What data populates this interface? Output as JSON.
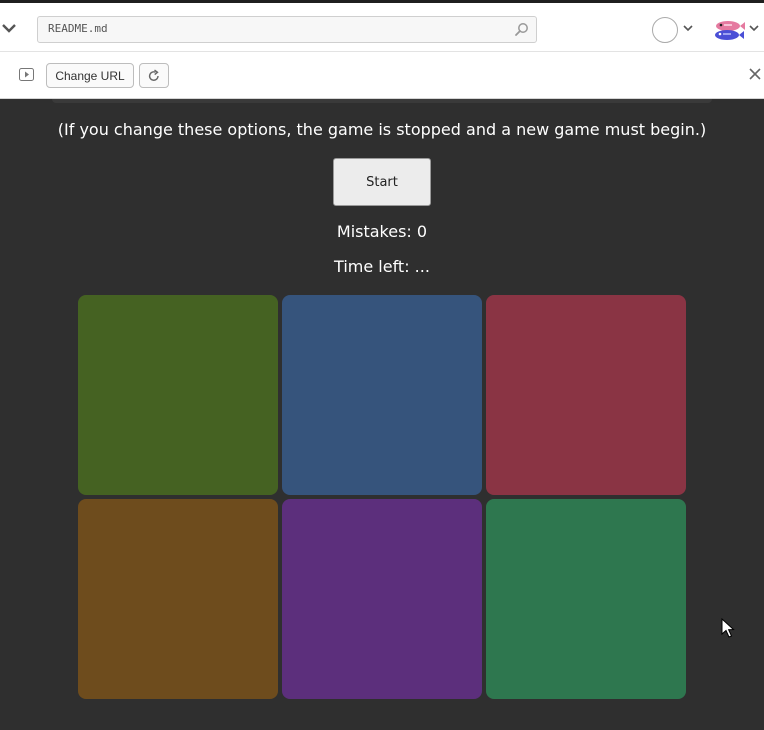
{
  "browser": {
    "url": "README.md",
    "change_url_label": "Change URL"
  },
  "game": {
    "note": "(If you change these options, the game is stopped and a new game must begin.)",
    "start_label": "Start",
    "mistakes_text": "Mistakes: 0",
    "time_left_text": "Time left: ...",
    "tiles": [
      {
        "color": "#456222"
      },
      {
        "color": "#36547c"
      },
      {
        "color": "#8a3444"
      },
      {
        "color": "#6e4c1d"
      },
      {
        "color": "#5c2f7c"
      },
      {
        "color": "#2e774f"
      }
    ]
  },
  "icons": {
    "search": "search-icon",
    "play": "play-icon",
    "reload": "reload-icon",
    "close": "close-icon",
    "chevron": "chevron-down-icon"
  }
}
